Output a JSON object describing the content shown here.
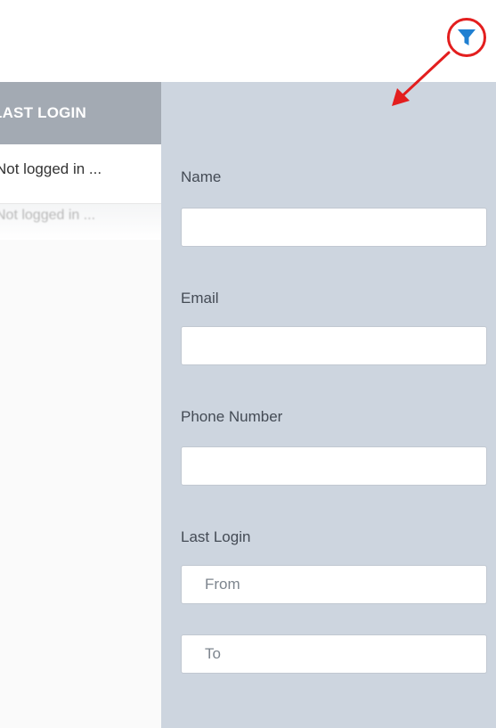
{
  "table": {
    "column_header": "LAST LOGIN",
    "rows": [
      {
        "last_login": "Not logged in ..."
      },
      {
        "last_login": "Not logged in ..."
      }
    ]
  },
  "filter": {
    "icon": "filter-funnel-icon",
    "name_label": "Name",
    "name_value": "",
    "email_label": "Email",
    "email_value": "",
    "phone_label": "Phone Number",
    "phone_value": "",
    "last_login_label": "Last Login",
    "from_placeholder": "From",
    "to_placeholder": "To"
  },
  "annotation": {
    "color": "#e31e1e",
    "icon": "arrow-icon"
  },
  "colors": {
    "panel_bg": "#cdd5df",
    "header_bg": "#a3aab3",
    "icon_blue": "#1f7fd1"
  }
}
